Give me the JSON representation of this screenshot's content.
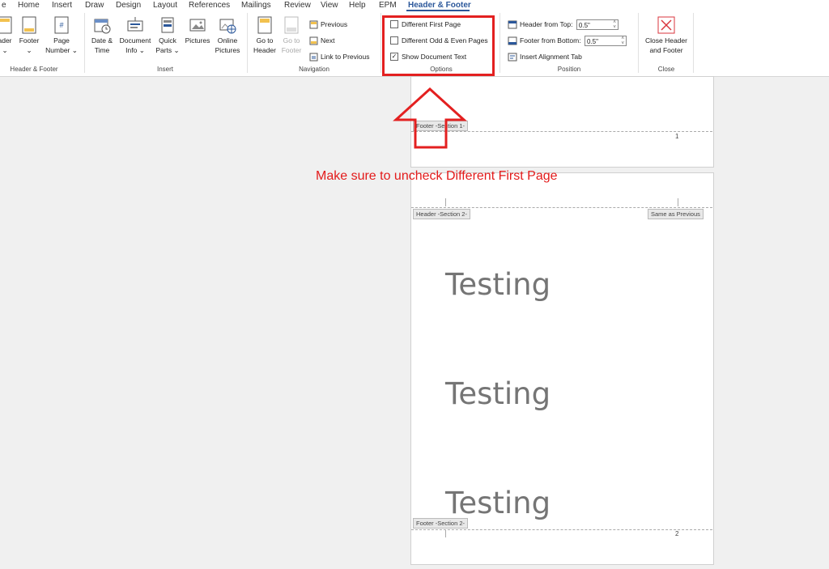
{
  "tabs": [
    "e",
    "Home",
    "Insert",
    "Draw",
    "Design",
    "Layout",
    "References",
    "Mailings",
    "Review",
    "View",
    "Help",
    "EPM",
    "Header & Footer"
  ],
  "ribbon": {
    "groups": {
      "header_footer": {
        "label": "Header & Footer",
        "buttons": [
          {
            "line1": "ader",
            "line2": "⌄"
          },
          {
            "line1": "Footer",
            "line2": "⌄"
          },
          {
            "line1": "Page",
            "line2": "Number ⌄"
          }
        ]
      },
      "insert": {
        "label": "Insert",
        "buttons": [
          {
            "line1": "Date &",
            "line2": "Time"
          },
          {
            "line1": "Document",
            "line2": "Info ⌄"
          },
          {
            "line1": "Quick",
            "line2": "Parts ⌄"
          },
          {
            "line1": "Pictures",
            "line2": ""
          },
          {
            "line1": "Online",
            "line2": "Pictures"
          }
        ]
      },
      "navigation": {
        "label": "Navigation",
        "go_to_header": {
          "line1": "Go to",
          "line2": "Header"
        },
        "go_to_footer": {
          "line1": "Go to",
          "line2": "Footer"
        },
        "previous": "Previous",
        "next": "Next",
        "link_to_previous": "Link to Previous"
      },
      "options": {
        "label": "Options",
        "different_first_page": {
          "label": "Different First Page",
          "checked": false,
          "mark": ""
        },
        "different_odd_even": {
          "label": "Different Odd & Even Pages",
          "checked": false,
          "mark": ""
        },
        "show_document_text": {
          "label": "Show Document Text",
          "checked": true,
          "mark": "✓"
        }
      },
      "position": {
        "label": "Position",
        "header_from_top": {
          "label": "Header from Top:",
          "value": "0.5\""
        },
        "footer_from_bottom": {
          "label": "Footer from Bottom:",
          "value": "0.5\""
        },
        "insert_alignment_tab": "Insert Alignment Tab"
      },
      "close": {
        "label": "Close",
        "close_button": {
          "line1": "Close Header",
          "line2": "and Footer"
        }
      }
    }
  },
  "document": {
    "page1": {
      "footer_tag": "Footer -Section 1-",
      "page_number": "1"
    },
    "page2": {
      "header_tag": "Header -Section 2-",
      "same_as_previous": "Same as Previous",
      "body_lines": [
        "Testing",
        "Testing",
        "Testing"
      ],
      "footer_tag": "Footer -Section 2-",
      "page_number": "2"
    }
  },
  "annotation": {
    "text": "Make sure to uncheck Different First Page",
    "color": "#e31b1b"
  },
  "colors": {
    "accent": "#2b579a",
    "highlight": "#e32020"
  }
}
